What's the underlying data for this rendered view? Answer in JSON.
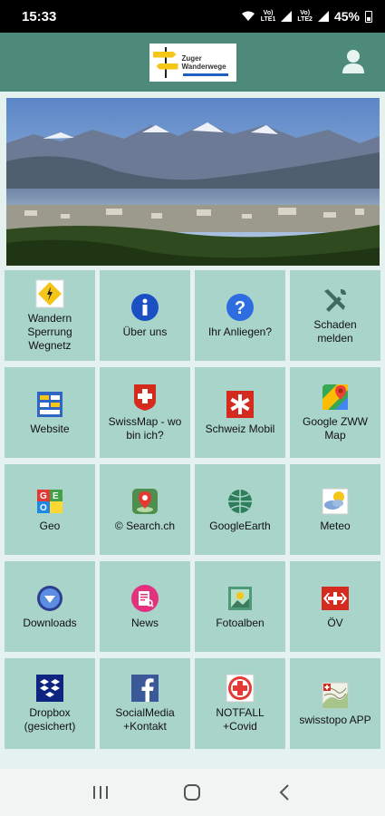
{
  "status_bar": {
    "time": "15:33",
    "network_1": "VoLTE LTE1",
    "network_2": "VoLTE LTE2",
    "battery": "45%"
  },
  "header": {
    "logo_line1": "Zuger",
    "logo_line2": "Wanderwege",
    "accent_color": "#4e8a79"
  },
  "hero": {
    "image": "mountain-lake-landscape"
  },
  "tiles": [
    {
      "label": "Wandern\nSperrung\nWegnetz",
      "icon": "warning-sign-icon"
    },
    {
      "label": "Über uns",
      "icon": "info-icon"
    },
    {
      "label": "Ihr Anliegen?",
      "icon": "help-icon"
    },
    {
      "label": "Schaden\nmelden",
      "icon": "tools-icon"
    },
    {
      "label": "Website",
      "icon": "website-icon"
    },
    {
      "label": "SwissMap - wo\nbin ich?",
      "icon": "swiss-flag-icon"
    },
    {
      "label": "Schweiz Mobil",
      "icon": "schweizmobil-icon"
    },
    {
      "label": "Google ZWW\nMap",
      "icon": "google-maps-icon"
    },
    {
      "label": "Geo",
      "icon": "geo-cubes-icon"
    },
    {
      "label": "© Search.ch",
      "icon": "map-pin-icon"
    },
    {
      "label": "GoogleEarth",
      "icon": "globe-icon"
    },
    {
      "label": "Meteo",
      "icon": "weather-icon"
    },
    {
      "label": "Downloads",
      "icon": "download-icon"
    },
    {
      "label": "News",
      "icon": "news-icon"
    },
    {
      "label": "Fotoalben",
      "icon": "photo-album-icon"
    },
    {
      "label": "ÖV",
      "icon": "sbb-icon"
    },
    {
      "label": "Dropbox\n(gesichert)",
      "icon": "dropbox-icon"
    },
    {
      "label": "SocialMedia\n+Kontakt",
      "icon": "facebook-icon"
    },
    {
      "label": "NOTFALL\n+Covid",
      "icon": "emergency-cross-icon"
    },
    {
      "label": "swisstopo APP",
      "icon": "swisstopo-icon"
    }
  ]
}
